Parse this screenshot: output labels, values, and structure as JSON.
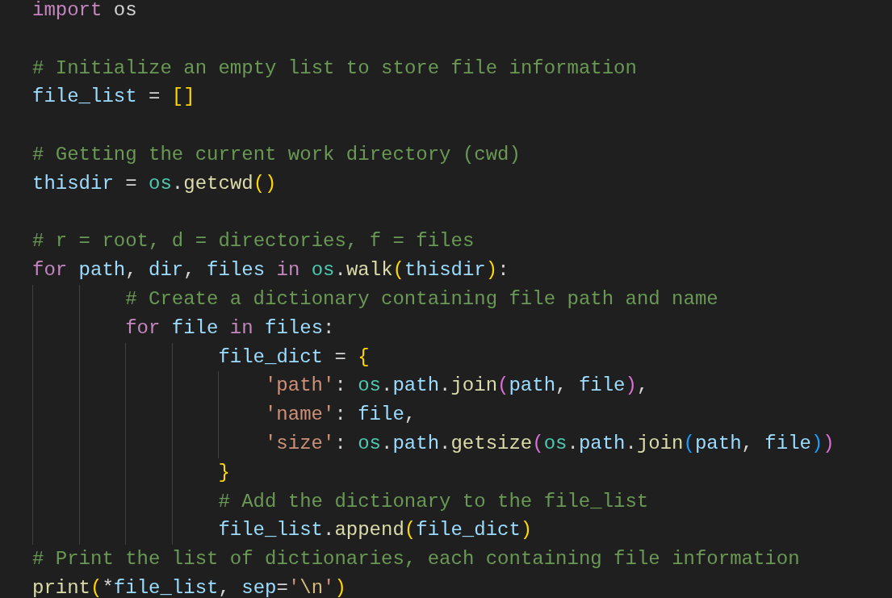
{
  "editor": {
    "lines": [
      {
        "kind": "code",
        "tokens": [
          {
            "kind": "keyword",
            "text": "import"
          },
          {
            "kind": "plain",
            "text": " os"
          }
        ]
      },
      {
        "kind": "blank"
      },
      {
        "kind": "code",
        "tokens": [
          {
            "kind": "comment",
            "text": "# Initialize an empty list to store file information"
          }
        ]
      },
      {
        "kind": "code",
        "tokens": [
          {
            "kind": "variable",
            "text": "file_list"
          },
          {
            "kind": "plain",
            "text": " = "
          },
          {
            "kind": "bracket1",
            "text": "[]"
          }
        ]
      },
      {
        "kind": "blank"
      },
      {
        "kind": "code",
        "tokens": [
          {
            "kind": "comment",
            "text": "# Getting the current work directory (cwd)"
          }
        ]
      },
      {
        "kind": "code",
        "tokens": [
          {
            "kind": "variable",
            "text": "thisdir"
          },
          {
            "kind": "plain",
            "text": " = "
          },
          {
            "kind": "module",
            "text": "os"
          },
          {
            "kind": "plain",
            "text": "."
          },
          {
            "kind": "function",
            "text": "getcwd"
          },
          {
            "kind": "bracket1",
            "text": "()"
          }
        ]
      },
      {
        "kind": "blank"
      },
      {
        "kind": "code",
        "tokens": [
          {
            "kind": "comment",
            "text": "# r = root, d = directories, f = files"
          }
        ]
      },
      {
        "kind": "code",
        "tokens": [
          {
            "kind": "keyword",
            "text": "for"
          },
          {
            "kind": "variable",
            "text": " path"
          },
          {
            "kind": "plain",
            "text": ", "
          },
          {
            "kind": "variable",
            "text": "dir"
          },
          {
            "kind": "plain",
            "text": ", "
          },
          {
            "kind": "variable",
            "text": "files"
          },
          {
            "kind": "keyword",
            "text": " in"
          },
          {
            "kind": "module",
            "text": " os"
          },
          {
            "kind": "plain",
            "text": "."
          },
          {
            "kind": "function",
            "text": "walk"
          },
          {
            "kind": "bracket1",
            "text": "("
          },
          {
            "kind": "variable",
            "text": "thisdir"
          },
          {
            "kind": "bracket1",
            "text": ")"
          },
          {
            "kind": "plain",
            "text": ":"
          }
        ]
      },
      {
        "kind": "code",
        "tokens": [
          {
            "kind": "comment",
            "text": "        # Create a dictionary containing file path and name"
          }
        ]
      },
      {
        "kind": "code",
        "tokens": [
          {
            "kind": "keyword",
            "text": "        for"
          },
          {
            "kind": "variable",
            "text": " file"
          },
          {
            "kind": "keyword",
            "text": " in"
          },
          {
            "kind": "variable",
            "text": " files"
          },
          {
            "kind": "plain",
            "text": ":"
          }
        ]
      },
      {
        "kind": "code",
        "tokens": [
          {
            "kind": "variable",
            "text": "                file_dict"
          },
          {
            "kind": "plain",
            "text": " = "
          },
          {
            "kind": "bracket1",
            "text": "{"
          }
        ]
      },
      {
        "kind": "code",
        "tokens": [
          {
            "kind": "string",
            "text": "                    'path'"
          },
          {
            "kind": "plain",
            "text": ": "
          },
          {
            "kind": "module",
            "text": "os"
          },
          {
            "kind": "plain",
            "text": "."
          },
          {
            "kind": "variable",
            "text": "path"
          },
          {
            "kind": "plain",
            "text": "."
          },
          {
            "kind": "function",
            "text": "join"
          },
          {
            "kind": "bracket2",
            "text": "("
          },
          {
            "kind": "variable",
            "text": "path"
          },
          {
            "kind": "plain",
            "text": ", "
          },
          {
            "kind": "variable",
            "text": "file"
          },
          {
            "kind": "bracket2",
            "text": ")"
          },
          {
            "kind": "plain",
            "text": ","
          }
        ]
      },
      {
        "kind": "code",
        "tokens": [
          {
            "kind": "string",
            "text": "                    'name'"
          },
          {
            "kind": "plain",
            "text": ": "
          },
          {
            "kind": "variable",
            "text": "file"
          },
          {
            "kind": "plain",
            "text": ","
          }
        ]
      },
      {
        "kind": "code",
        "tokens": [
          {
            "kind": "string",
            "text": "                    'size'"
          },
          {
            "kind": "plain",
            "text": ": "
          },
          {
            "kind": "module",
            "text": "os"
          },
          {
            "kind": "plain",
            "text": "."
          },
          {
            "kind": "variable",
            "text": "path"
          },
          {
            "kind": "plain",
            "text": "."
          },
          {
            "kind": "function",
            "text": "getsize"
          },
          {
            "kind": "bracket2",
            "text": "("
          },
          {
            "kind": "module",
            "text": "os"
          },
          {
            "kind": "plain",
            "text": "."
          },
          {
            "kind": "variable",
            "text": "path"
          },
          {
            "kind": "plain",
            "text": "."
          },
          {
            "kind": "function",
            "text": "join"
          },
          {
            "kind": "bracket3",
            "text": "("
          },
          {
            "kind": "variable",
            "text": "path"
          },
          {
            "kind": "plain",
            "text": ", "
          },
          {
            "kind": "variable",
            "text": "file"
          },
          {
            "kind": "bracket3",
            "text": ")"
          },
          {
            "kind": "bracket2",
            "text": ")"
          }
        ]
      },
      {
        "kind": "code",
        "tokens": [
          {
            "kind": "bracket1",
            "text": "                }"
          }
        ]
      },
      {
        "kind": "code",
        "tokens": [
          {
            "kind": "comment",
            "text": "                # Add the dictionary to the file_list"
          }
        ]
      },
      {
        "kind": "code",
        "tokens": [
          {
            "kind": "variable",
            "text": "                file_list"
          },
          {
            "kind": "plain",
            "text": "."
          },
          {
            "kind": "function",
            "text": "append"
          },
          {
            "kind": "bracket1",
            "text": "("
          },
          {
            "kind": "variable",
            "text": "file_dict"
          },
          {
            "kind": "bracket1",
            "text": ")"
          }
        ]
      },
      {
        "kind": "code",
        "tokens": [
          {
            "kind": "comment",
            "text": "# Print the list of dictionaries, each containing file information"
          }
        ]
      },
      {
        "kind": "code",
        "tokens": [
          {
            "kind": "function",
            "text": "print"
          },
          {
            "kind": "bracket1",
            "text": "("
          },
          {
            "kind": "plain",
            "text": "*"
          },
          {
            "kind": "variable",
            "text": "file_list"
          },
          {
            "kind": "plain",
            "text": ", "
          },
          {
            "kind": "variable",
            "text": "sep"
          },
          {
            "kind": "plain",
            "text": "="
          },
          {
            "kind": "string",
            "text": "'"
          },
          {
            "kind": "escape",
            "text": "\\n"
          },
          {
            "kind": "string",
            "text": "'"
          },
          {
            "kind": "bracket1",
            "text": ")"
          }
        ]
      }
    ]
  }
}
